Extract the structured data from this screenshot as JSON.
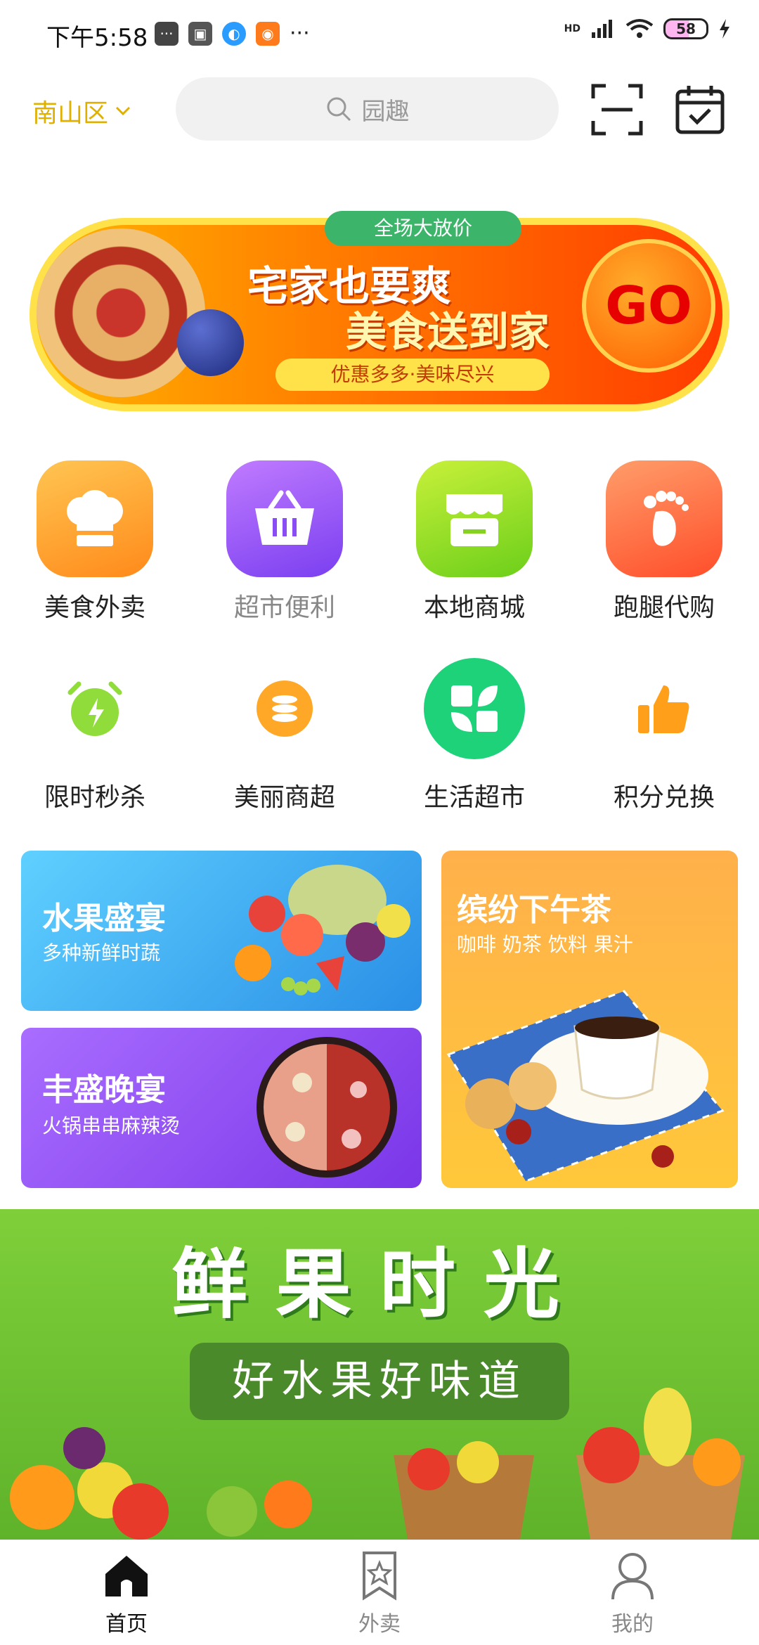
{
  "status_bar": {
    "time": "下午5:58",
    "more": "···",
    "network": "HD",
    "battery": "58"
  },
  "header": {
    "location": "南山区",
    "search_placeholder": "园趣"
  },
  "promo": {
    "pill": "全场大放价",
    "line1": "宅家也要爽",
    "line2": "美食送到家",
    "subtitle": "优惠多多·美味尽兴",
    "go": "GO"
  },
  "categories_row1": [
    {
      "label": "美食外卖",
      "icon": "chef-hat-icon"
    },
    {
      "label": "超市便利",
      "icon": "basket-icon"
    },
    {
      "label": "本地商城",
      "icon": "store-icon"
    },
    {
      "label": "跑腿代购",
      "icon": "footprint-icon"
    }
  ],
  "categories_row2": [
    {
      "label": "限时秒杀",
      "icon": "alarm-clock-icon"
    },
    {
      "label": "美丽商超",
      "icon": "coins-icon"
    },
    {
      "label": "生活超市",
      "icon": "leaf-grid-icon"
    },
    {
      "label": "积分兑换",
      "icon": "thumbs-up-icon"
    }
  ],
  "cards": {
    "fruit": {
      "title": "水果盛宴",
      "subtitle": "多种新鲜时蔬"
    },
    "tea": {
      "title": "缤纷下午茶",
      "subtitle": "咖啡 奶茶 饮料 果汁"
    },
    "dinner": {
      "title": "丰盛晚宴",
      "subtitle": "火锅串串麻辣烫"
    }
  },
  "fruit_banner": {
    "title": "鲜果时光",
    "subtitle": "好水果好味道"
  },
  "bottom_nav": [
    {
      "label": "首页",
      "icon": "home-icon",
      "active": true
    },
    {
      "label": "外卖",
      "icon": "bookmark-star-icon",
      "active": false
    },
    {
      "label": "我的",
      "icon": "user-icon",
      "active": false
    }
  ],
  "colors": {
    "accent": "#e0b000",
    "promo_orange": "#ff7a00",
    "fruit_green": "#6cc234"
  }
}
